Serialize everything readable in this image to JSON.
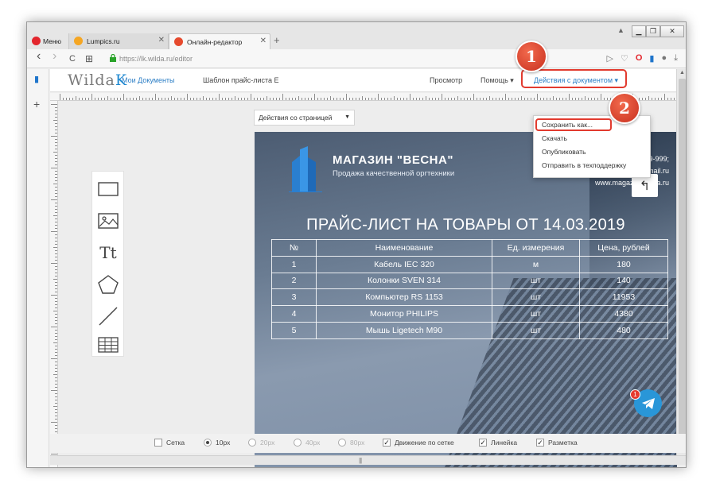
{
  "browser": {
    "tabs": [
      {
        "label": "Меню",
        "color": "#e3262d"
      },
      {
        "label": "Lumpics.ru",
        "color": "#f5a623"
      },
      {
        "label": "Онлайн-редактор",
        "color": "#e64a2e"
      }
    ],
    "new_tab": "+",
    "url": "https://lk.wilda.ru/editor",
    "nav": {
      "back": "‹",
      "forward": "›",
      "reload": "C",
      "speed_dial": "⊞"
    }
  },
  "sidebar": {
    "add": "+"
  },
  "topmenu": {
    "logo_main": "Wilda",
    "logo_k": "K",
    "my_documents": "Мои Документы",
    "template_name": "Шаблон прайс-листа Е",
    "preview": "Просмотр",
    "help": "Помощь ▾",
    "doc_actions": "Действия с документом ▾"
  },
  "dropdown": {
    "items": [
      "Сохранить как...",
      "Скачать",
      "Опубликовать",
      "Отправить в техподдержку"
    ]
  },
  "page_actions": {
    "label": "Действия со страницей",
    "caret": "▼"
  },
  "tools": {
    "items": [
      "rectangle-tool",
      "image-tool",
      "text-tool",
      "pentagon-tool",
      "line-tool",
      "table-tool"
    ],
    "text_glyph": "Tt"
  },
  "document": {
    "shop_title": "МАГАЗИН \"ВЕСНА\"",
    "shop_subtitle": "Продажа качественной оргтехники",
    "phone": "Тел: 9-999-999;",
    "email": "E-mail: vesna@mail.ru",
    "site": "www.magazin-vesna.ru",
    "heading": "ПРАЙС-ЛИСТ НА ТОВАРЫ ОТ 14.03.2019",
    "table": {
      "headers": [
        "№",
        "Наименование",
        "Ед. измерения",
        "Цена, рублей"
      ],
      "rows": [
        [
          "1",
          "Кабель IEC 320",
          "м",
          "180"
        ],
        [
          "2",
          "Колонки SVEN 314",
          "шт",
          "140"
        ],
        [
          "3",
          "Компьютер RS 1153",
          "шт",
          "11953"
        ],
        [
          "4",
          "Монитор PHILIPS",
          "шт",
          "4380"
        ],
        [
          "5",
          "Мышь Ligetech M90",
          "шт",
          "480"
        ]
      ]
    }
  },
  "bottombar": {
    "grid": "Сетка",
    "step_10": "10px",
    "step_20": "20px",
    "step_40": "40px",
    "step_80": "80px",
    "snap": "Движение по сетке",
    "ruler": "Линейка",
    "markup": "Разметка"
  },
  "telegram_badge": "1",
  "callouts": {
    "one": "1",
    "two": "2"
  },
  "colors": {
    "accent_blue": "#2d7fc6",
    "callout_red": "#d8402a",
    "telegram": "#2996d8"
  }
}
